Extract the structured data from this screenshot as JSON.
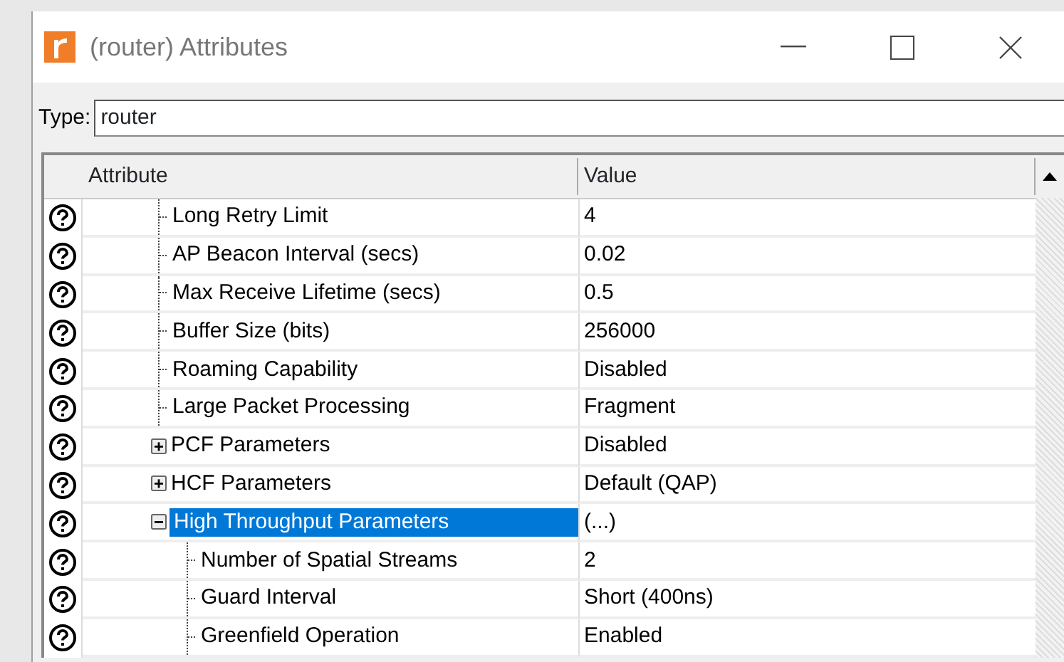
{
  "window": {
    "title": "(router) Attributes"
  },
  "type_field": {
    "label": "Type:",
    "value": "router"
  },
  "table": {
    "columns": [
      "Attribute",
      "Value"
    ],
    "rows": [
      {
        "kind": "leaf",
        "name": "Long Retry Limit",
        "value": "4",
        "selected": false
      },
      {
        "kind": "leaf",
        "name": "AP Beacon Interval (secs)",
        "value": "0.02",
        "selected": false
      },
      {
        "kind": "leaf",
        "name": "Max Receive Lifetime (secs)",
        "value": "0.5",
        "selected": false
      },
      {
        "kind": "leaf",
        "name": "Buffer Size (bits)",
        "value": "256000",
        "selected": false
      },
      {
        "kind": "leaf",
        "name": "Roaming Capability",
        "value": "Disabled",
        "selected": false
      },
      {
        "kind": "leaf",
        "name": "Large Packet Processing",
        "value": "Fragment",
        "selected": false
      },
      {
        "kind": "group",
        "name": "PCF Parameters",
        "value": "Disabled",
        "selected": false,
        "expanded": false
      },
      {
        "kind": "group",
        "name": "HCF Parameters",
        "value": "Default (QAP)",
        "selected": false,
        "expanded": false
      },
      {
        "kind": "group",
        "name": "High Throughput Parameters",
        "value": "(...)",
        "selected": true,
        "expanded": true,
        "children": [
          {
            "kind": "leaf",
            "name": "Number of Spatial Streams",
            "value": "2",
            "selected": false
          },
          {
            "kind": "leaf",
            "name": "Guard Interval",
            "value": "Short (400ns)",
            "selected": false
          },
          {
            "kind": "leaf",
            "name": "Greenfield Operation",
            "value": "Enabled",
            "selected": false
          }
        ]
      }
    ]
  }
}
